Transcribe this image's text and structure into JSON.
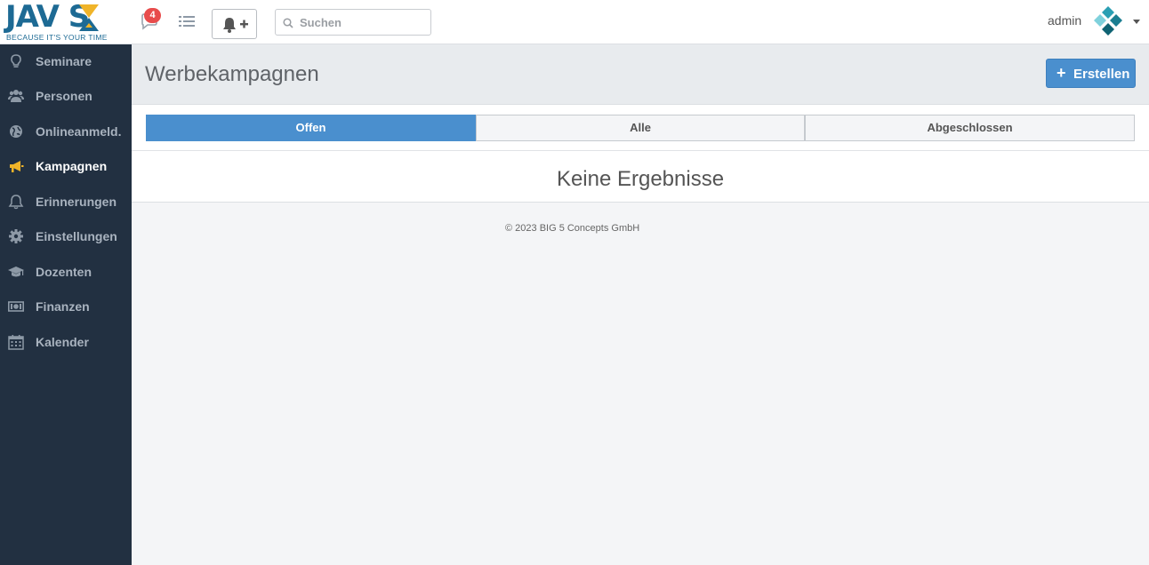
{
  "brand": {
    "logo_word": "JAV  S",
    "tagline": "BECAUSE IT'S YOUR TIME"
  },
  "topbar": {
    "notification_count": "4",
    "search_placeholder": "Suchen",
    "user_name": "admin"
  },
  "sidebar": {
    "items": [
      {
        "label": "Seminare",
        "icon": "lightbulb-icon"
      },
      {
        "label": "Personen",
        "icon": "users-icon"
      },
      {
        "label": "Onlineanmeld.",
        "icon": "globe-icon"
      },
      {
        "label": "Kampagnen",
        "icon": "megaphone-icon",
        "active": true
      },
      {
        "label": "Erinnerungen",
        "icon": "bell-icon"
      },
      {
        "label": "Einstellungen",
        "icon": "gear-icon"
      },
      {
        "label": "Dozenten",
        "icon": "graduation-cap-icon"
      },
      {
        "label": "Finanzen",
        "icon": "money-icon"
      },
      {
        "label": "Kalender",
        "icon": "calendar-icon"
      }
    ]
  },
  "page": {
    "title": "Werbekampagnen",
    "create_label": "Erstellen",
    "tabs": [
      {
        "label": "Offen",
        "active": true
      },
      {
        "label": "Alle"
      },
      {
        "label": "Abgeschlossen"
      }
    ],
    "empty_message": "Keine Ergebnisse",
    "footer": "© 2023 BIG 5 Concepts GmbH"
  },
  "colors": {
    "sidebar_bg": "#223041",
    "accent": "#4a8fce",
    "active_icon": "#f0b429",
    "brand_blue": "#1d6a94",
    "badge": "#e84c4c"
  }
}
